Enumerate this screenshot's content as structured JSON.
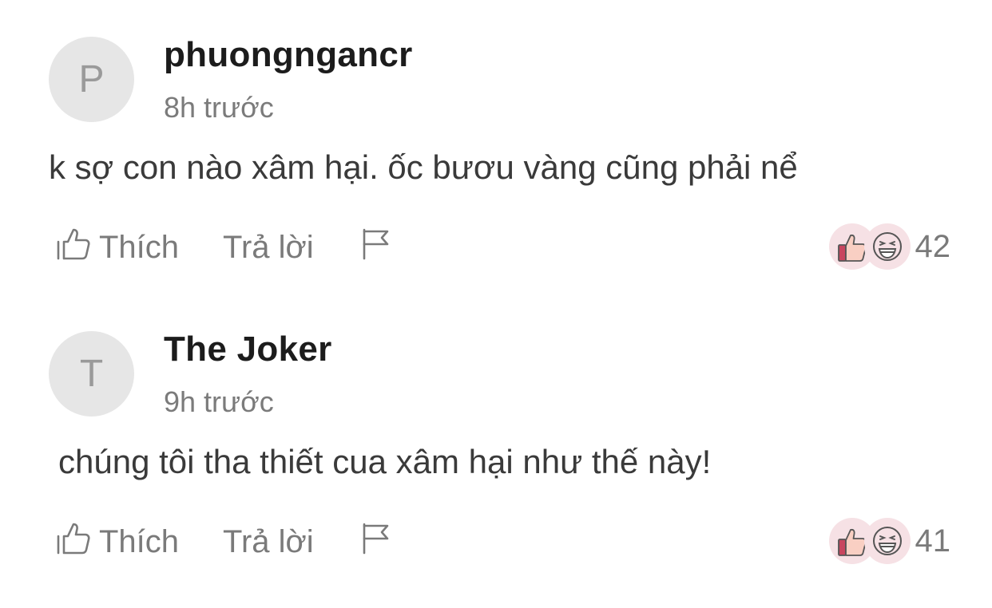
{
  "comments": [
    {
      "avatar_letter": "P",
      "username": "phuongngancr",
      "time": "8h trước",
      "text": "k sợ con nào xâm hại. ốc bươu vàng cũng phải nể",
      "like_label": "Thích",
      "reply_label": "Trả lời",
      "reaction_count": "42"
    },
    {
      "avatar_letter": "T",
      "username": "The Joker",
      "time": "9h trước",
      "text": "chúng tôi tha thiết cua xâm hại như thế này!",
      "like_label": "Thích",
      "reply_label": "Trả lời",
      "reaction_count": "41"
    }
  ],
  "icons": {
    "like": "thumbs-up-outline-icon",
    "report": "flag-icon",
    "reaction_like": "thumbs-up-reaction-icon",
    "reaction_laugh": "laughing-face-reaction-icon"
  },
  "colors": {
    "username": "#1c1c1c",
    "muted": "#7a7a7a",
    "avatar_bg": "#e6e6e6",
    "reaction_bg": "#f6e1e5",
    "reaction_accent": "#c8465f"
  }
}
